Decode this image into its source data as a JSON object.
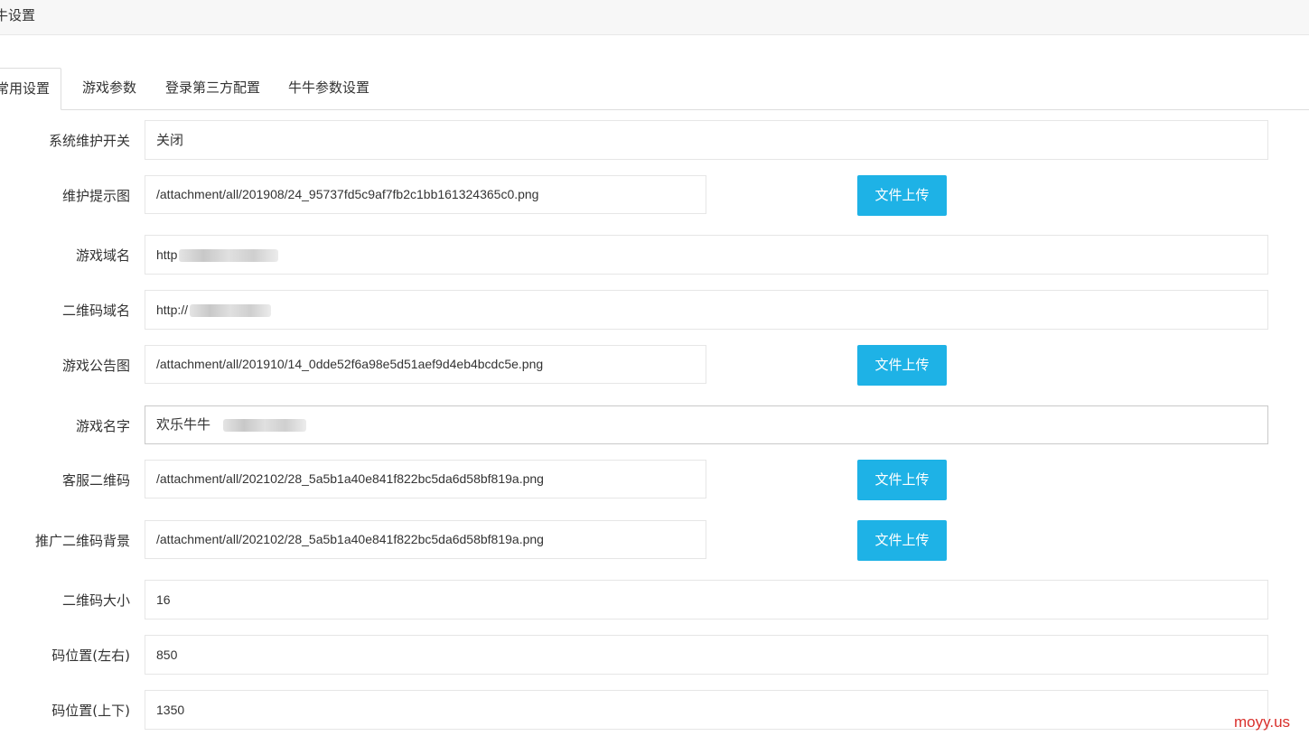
{
  "header": {
    "title": "牛设置"
  },
  "tabs": [
    {
      "label": "常用设置",
      "active": true
    },
    {
      "label": "游戏参数",
      "active": false
    },
    {
      "label": "登录第三方配置",
      "active": false
    },
    {
      "label": "牛牛参数设置",
      "active": false
    }
  ],
  "form": {
    "maintenance_switch": {
      "label": "系统维护开关",
      "value": "关闭"
    },
    "maintenance_image": {
      "label": "维护提示图",
      "value": "/attachment/all/201908/24_95737fd5c9af7fb2c1bb161324365c0.png",
      "button": "文件上传"
    },
    "game_domain": {
      "label": "游戏域名",
      "value": "http"
    },
    "qrcode_domain": {
      "label": "二维码域名",
      "value": "http://"
    },
    "notice_image": {
      "label": "游戏公告图",
      "value": "/attachment/all/201910/14_0dde52f6a98e5d51aef9d4eb4bcdc5e.png",
      "button": "文件上传"
    },
    "game_name": {
      "label": "游戏名字",
      "value": "欢乐牛牛"
    },
    "service_qrcode": {
      "label": "客服二维码",
      "value": "/attachment/all/202102/28_5a5b1a40e841f822bc5da6d58bf819a.png",
      "button": "文件上传"
    },
    "promo_qrcode_bg": {
      "label": "推广二维码背景",
      "value": "/attachment/all/202102/28_5a5b1a40e841f822bc5da6d58bf819a.png",
      "button": "文件上传"
    },
    "qrcode_size": {
      "label": "二维码大小",
      "value": "16"
    },
    "qrcode_pos_x": {
      "label": "码位置(左右)",
      "value": "850"
    },
    "qrcode_pos_y": {
      "label": "码位置(上下)",
      "value": "1350"
    }
  },
  "watermark": "moyy.us",
  "colors": {
    "accent": "#1eb2e6",
    "watermark": "#d9302c"
  }
}
